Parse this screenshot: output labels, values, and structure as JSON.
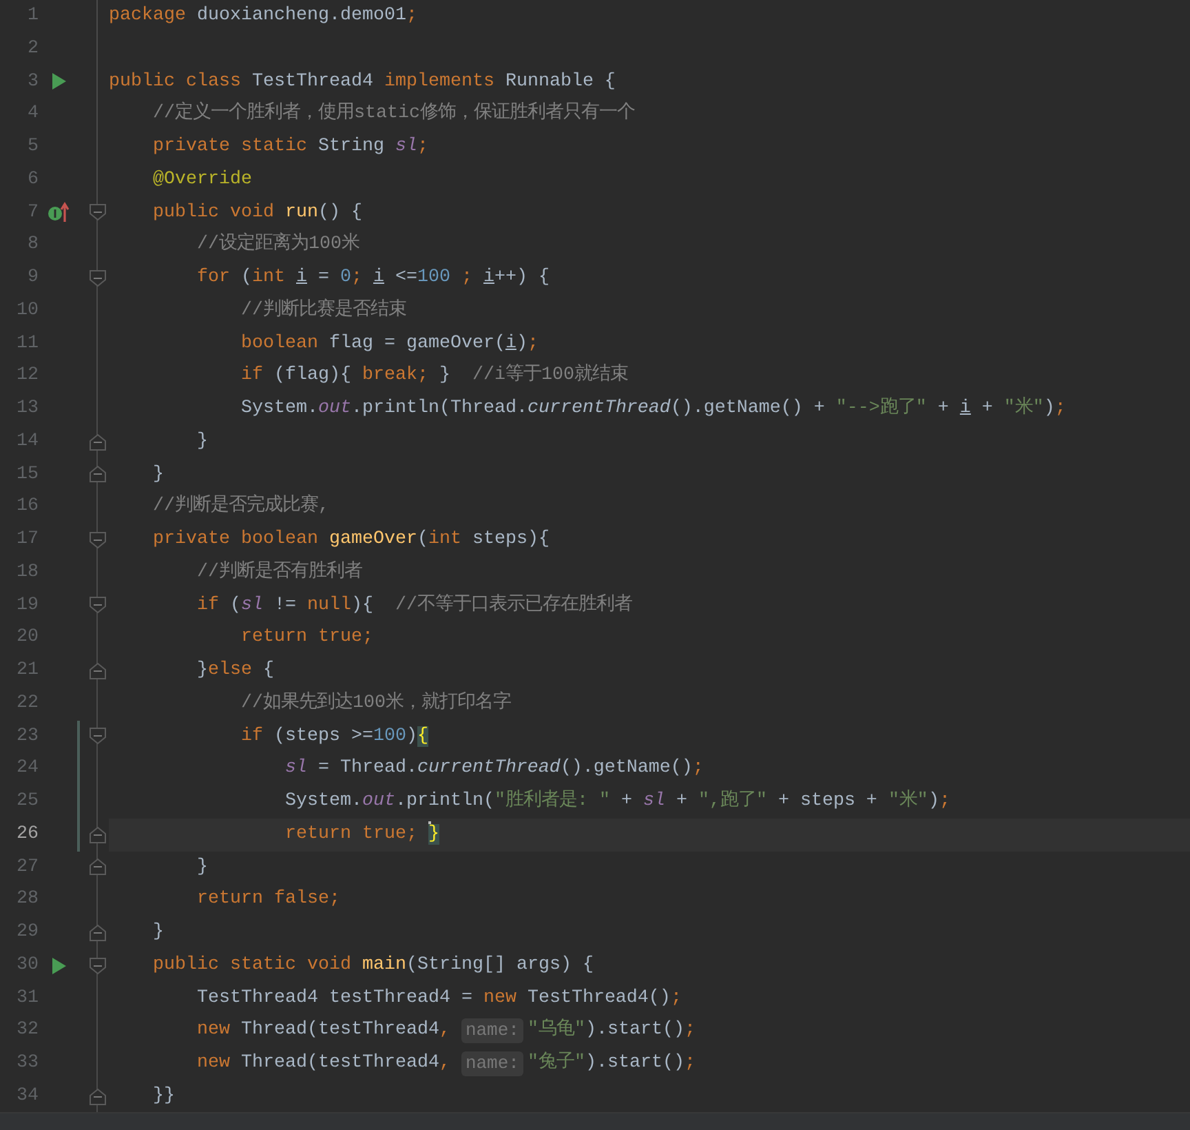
{
  "editor": {
    "lines": [
      {
        "number": "1",
        "selected": false,
        "changed": false,
        "tokens": [
          {
            "kind": "keyword",
            "text": "package"
          },
          {
            "kind": "plain",
            "text": " duoxiancheng.demo01"
          },
          {
            "kind": "keyword",
            "text": ";"
          }
        ]
      },
      {
        "number": "2",
        "selected": false,
        "changed": false
      },
      {
        "number": "3",
        "selected": false,
        "changed": false,
        "marker": {
          "kind": "run"
        },
        "tokens": [
          {
            "kind": "keyword",
            "text": "public class "
          },
          {
            "kind": "plain",
            "text": "TestThread4 "
          },
          {
            "kind": "keyword",
            "text": "implements "
          },
          {
            "kind": "plain",
            "text": "Runnable {"
          }
        ]
      },
      {
        "number": "4",
        "selected": false,
        "changed": false,
        "tokens": [
          {
            "kind": "comment",
            "text": "    //定义一个胜利者，使用static修饰，保证胜利者只有一个"
          }
        ]
      },
      {
        "number": "5",
        "selected": false,
        "changed": false,
        "tokens": [
          {
            "kind": "keyword",
            "text": "    private static "
          },
          {
            "kind": "plain",
            "text": "String "
          },
          {
            "kind": "field",
            "text": "sl"
          },
          {
            "kind": "keyword",
            "text": ";"
          }
        ]
      },
      {
        "number": "6",
        "selected": false,
        "changed": false,
        "tokens": [
          {
            "kind": "annotation",
            "text": "    @Override"
          }
        ]
      },
      {
        "number": "7",
        "selected": false,
        "changed": false,
        "marker": {
          "kind": "implements"
        },
        "fold": {
          "kind": "start"
        },
        "tokens": [
          {
            "kind": "keyword",
            "text": "    public void "
          },
          {
            "kind": "method",
            "text": "run"
          },
          {
            "kind": "plain",
            "text": "() {"
          }
        ]
      },
      {
        "number": "8",
        "selected": false,
        "changed": false,
        "tokens": [
          {
            "kind": "comment",
            "text": "        //设定距离为100米"
          }
        ]
      },
      {
        "number": "9",
        "selected": false,
        "changed": false,
        "fold": {
          "kind": "start"
        },
        "tokens": [
          {
            "kind": "keyword",
            "text": "        for"
          },
          {
            "kind": "plain",
            "text": " ("
          },
          {
            "kind": "keyword",
            "text": "int "
          },
          {
            "kind": "var",
            "text": "i"
          },
          {
            "kind": "plain",
            "text": " = "
          },
          {
            "kind": "number",
            "text": "0"
          },
          {
            "kind": "keyword",
            "text": "; "
          },
          {
            "kind": "var",
            "text": "i"
          },
          {
            "kind": "plain",
            "text": " <="
          },
          {
            "kind": "number",
            "text": "100"
          },
          {
            "kind": "keyword",
            "text": " ; "
          },
          {
            "kind": "var",
            "text": "i"
          },
          {
            "kind": "plain",
            "text": "++) {"
          }
        ]
      },
      {
        "number": "10",
        "selected": false,
        "changed": false,
        "tokens": [
          {
            "kind": "comment",
            "text": "            //判断比赛是否结束"
          }
        ]
      },
      {
        "number": "11",
        "selected": false,
        "changed": false,
        "tokens": [
          {
            "kind": "keyword",
            "text": "            boolean"
          },
          {
            "kind": "plain",
            "text": " flag = gameOver("
          },
          {
            "kind": "var",
            "text": "i"
          },
          {
            "kind": "plain",
            "text": ")"
          },
          {
            "kind": "keyword",
            "text": ";"
          }
        ]
      },
      {
        "number": "12",
        "selected": false,
        "changed": false,
        "tokens": [
          {
            "kind": "keyword",
            "text": "            if"
          },
          {
            "kind": "plain",
            "text": " (flag){ "
          },
          {
            "kind": "keyword",
            "text": "break;"
          },
          {
            "kind": "plain",
            "text": " }  "
          },
          {
            "kind": "comment",
            "text": "//i等于100就结束"
          }
        ]
      },
      {
        "number": "13",
        "selected": false,
        "changed": false,
        "tokens": [
          {
            "kind": "plain",
            "text": "            System."
          },
          {
            "kind": "field",
            "text": "out"
          },
          {
            "kind": "plain",
            "text": ".println(Thread."
          },
          {
            "kind": "static",
            "text": "currentThread"
          },
          {
            "kind": "plain",
            "text": "().getName() + "
          },
          {
            "kind": "string",
            "text": "\"-->跑了\""
          },
          {
            "kind": "plain",
            "text": " + "
          },
          {
            "kind": "var",
            "text": "i"
          },
          {
            "kind": "plain",
            "text": " + "
          },
          {
            "kind": "string",
            "text": "\"米\""
          },
          {
            "kind": "plain",
            "text": ")"
          },
          {
            "kind": "keyword",
            "text": ";"
          }
        ]
      },
      {
        "number": "14",
        "selected": false,
        "changed": false,
        "fold": {
          "kind": "end"
        },
        "tokens": [
          {
            "kind": "plain",
            "text": "        }"
          }
        ]
      },
      {
        "number": "15",
        "selected": false,
        "changed": false,
        "fold": {
          "kind": "end"
        },
        "tokens": [
          {
            "kind": "plain",
            "text": "    }"
          }
        ]
      },
      {
        "number": "16",
        "selected": false,
        "changed": false,
        "tokens": [
          {
            "kind": "comment",
            "text": "    //判断是否完成比赛,"
          }
        ]
      },
      {
        "number": "17",
        "selected": false,
        "changed": false,
        "fold": {
          "kind": "start"
        },
        "tokens": [
          {
            "kind": "keyword",
            "text": "    private boolean "
          },
          {
            "kind": "method",
            "text": "gameOver"
          },
          {
            "kind": "plain",
            "text": "("
          },
          {
            "kind": "keyword",
            "text": "int"
          },
          {
            "kind": "plain",
            "text": " steps){"
          }
        ]
      },
      {
        "number": "18",
        "selected": false,
        "changed": false,
        "tokens": [
          {
            "kind": "comment",
            "text": "        //判断是否有胜利者"
          }
        ]
      },
      {
        "number": "19",
        "selected": false,
        "changed": false,
        "fold": {
          "kind": "start"
        },
        "tokens": [
          {
            "kind": "keyword",
            "text": "        if"
          },
          {
            "kind": "plain",
            "text": " ("
          },
          {
            "kind": "field",
            "text": "sl"
          },
          {
            "kind": "plain",
            "text": " != "
          },
          {
            "kind": "keyword",
            "text": "null"
          },
          {
            "kind": "plain",
            "text": "){  "
          },
          {
            "kind": "comment",
            "text": "//不等于口表示已存在胜利者"
          }
        ]
      },
      {
        "number": "20",
        "selected": false,
        "changed": false,
        "tokens": [
          {
            "kind": "keyword",
            "text": "            return true;"
          }
        ]
      },
      {
        "number": "21",
        "selected": false,
        "changed": false,
        "fold": {
          "kind": "end"
        },
        "tokens": [
          {
            "kind": "plain",
            "text": "        }"
          },
          {
            "kind": "keyword",
            "text": "else"
          },
          {
            "kind": "plain",
            "text": " {"
          }
        ]
      },
      {
        "number": "22",
        "selected": false,
        "changed": false,
        "tokens": [
          {
            "kind": "comment",
            "text": "            //如果先到达100米，就打印名字"
          }
        ]
      },
      {
        "number": "23",
        "selected": false,
        "changed": true,
        "fold": {
          "kind": "start"
        },
        "tokens": [
          {
            "kind": "keyword",
            "text": "            if"
          },
          {
            "kind": "plain",
            "text": " (steps >="
          },
          {
            "kind": "number",
            "text": "100"
          },
          {
            "kind": "plain",
            "text": ")"
          },
          {
            "kind": "brace",
            "text": "{"
          }
        ]
      },
      {
        "number": "24",
        "selected": false,
        "changed": true,
        "tokens": [
          {
            "kind": "field",
            "text": "                sl"
          },
          {
            "kind": "plain",
            "text": " = Thread."
          },
          {
            "kind": "static",
            "text": "currentThread"
          },
          {
            "kind": "plain",
            "text": "().getName()"
          },
          {
            "kind": "keyword",
            "text": ";"
          }
        ]
      },
      {
        "number": "25",
        "selected": false,
        "changed": true,
        "tokens": [
          {
            "kind": "plain",
            "text": "                System."
          },
          {
            "kind": "field",
            "text": "out"
          },
          {
            "kind": "plain",
            "text": ".println("
          },
          {
            "kind": "string",
            "text": "\"胜利者是: \""
          },
          {
            "kind": "plain",
            "text": " + "
          },
          {
            "kind": "field",
            "text": "sl"
          },
          {
            "kind": "plain",
            "text": " + "
          },
          {
            "kind": "string",
            "text": "\",跑了\""
          },
          {
            "kind": "plain",
            "text": " + steps + "
          },
          {
            "kind": "string",
            "text": "\"米\""
          },
          {
            "kind": "plain",
            "text": ")"
          },
          {
            "kind": "keyword",
            "text": ";"
          }
        ]
      },
      {
        "number": "26",
        "selected": true,
        "changed": true,
        "caret": true,
        "fold": {
          "kind": "end"
        },
        "tokens": [
          {
            "kind": "keyword",
            "text": "                return true; "
          },
          {
            "kind": "brace",
            "text": "}"
          }
        ]
      },
      {
        "number": "27",
        "selected": false,
        "changed": false,
        "fold": {
          "kind": "end"
        },
        "tokens": [
          {
            "kind": "plain",
            "text": "        }"
          }
        ]
      },
      {
        "number": "28",
        "selected": false,
        "changed": false,
        "tokens": [
          {
            "kind": "keyword",
            "text": "        return false;"
          }
        ]
      },
      {
        "number": "29",
        "selected": false,
        "changed": false,
        "fold": {
          "kind": "end"
        },
        "tokens": [
          {
            "kind": "plain",
            "text": "    }"
          }
        ]
      },
      {
        "number": "30",
        "selected": false,
        "changed": false,
        "marker": {
          "kind": "run"
        },
        "fold": {
          "kind": "start"
        },
        "tokens": [
          {
            "kind": "keyword",
            "text": "    public static void "
          },
          {
            "kind": "method",
            "text": "main"
          },
          {
            "kind": "plain",
            "text": "(String[] args) {"
          }
        ]
      },
      {
        "number": "31",
        "selected": false,
        "changed": false,
        "tokens": [
          {
            "kind": "plain",
            "text": "        TestThread4 testThread4 = "
          },
          {
            "kind": "keyword",
            "text": "new"
          },
          {
            "kind": "plain",
            "text": " TestThread4()"
          },
          {
            "kind": "keyword",
            "text": ";"
          }
        ]
      },
      {
        "number": "32",
        "selected": false,
        "changed": false,
        "tokens": [
          {
            "kind": "keyword",
            "text": "        new"
          },
          {
            "kind": "plain",
            "text": " Thread(testThread4"
          },
          {
            "kind": "keyword",
            "text": ", "
          },
          {
            "kind": "hint",
            "text": "name:"
          },
          {
            "kind": "string",
            "text": "\"乌龟\""
          },
          {
            "kind": "plain",
            "text": ").start()"
          },
          {
            "kind": "keyword",
            "text": ";"
          }
        ]
      },
      {
        "number": "33",
        "selected": false,
        "changed": false,
        "tokens": [
          {
            "kind": "keyword",
            "text": "        new"
          },
          {
            "kind": "plain",
            "text": " Thread(testThread4"
          },
          {
            "kind": "keyword",
            "text": ", "
          },
          {
            "kind": "hint",
            "text": "name:"
          },
          {
            "kind": "string",
            "text": "\"兔子\""
          },
          {
            "kind": "plain",
            "text": ").start()"
          },
          {
            "kind": "keyword",
            "text": ";"
          }
        ]
      },
      {
        "number": "34",
        "selected": false,
        "changed": false,
        "fold": {
          "kind": "end"
        },
        "tokens": [
          {
            "kind": "plain",
            "text": "    }}"
          }
        ]
      }
    ]
  }
}
